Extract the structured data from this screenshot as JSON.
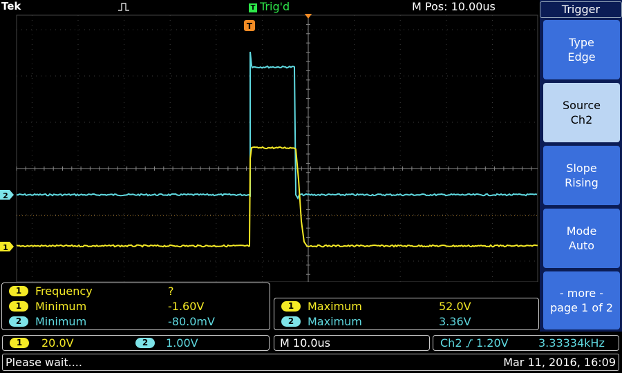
{
  "header": {
    "brand": "Tek",
    "trigger_status": "Trig'd",
    "trigger_status_badge": "T",
    "horizontal_position": "M Pos: 10.00us",
    "trigger_marker": "T"
  },
  "channel_markers": {
    "ch1": "1",
    "ch2": "2"
  },
  "side_menu": {
    "title": "Trigger",
    "buttons": [
      {
        "line1": "Type",
        "line2": "Edge"
      },
      {
        "line1": "Source",
        "line2": "Ch2"
      },
      {
        "line1": "Slope",
        "line2": "Rising"
      },
      {
        "line1": "Mode",
        "line2": "Auto"
      },
      {
        "line1": "- more -",
        "line2": "page 1 of 2"
      }
    ]
  },
  "measurements_left": [
    {
      "channel": "1",
      "name": "Frequency",
      "value": "?"
    },
    {
      "channel": "1",
      "name": "Minimum",
      "value": "-1.60V"
    },
    {
      "channel": "2",
      "name": "Minimum",
      "value": "-80.0mV"
    }
  ],
  "measurements_right": [
    {
      "channel": "1",
      "name": "Maximum",
      "value": "52.0V"
    },
    {
      "channel": "2",
      "name": "Maximum",
      "value": "3.36V"
    }
  ],
  "scales": {
    "ch1_channel": "1",
    "ch1_scale": "20.0V",
    "ch2_channel": "2",
    "ch2_scale": "1.00V",
    "horizontal": "M 10.0us",
    "trigger_source": "Ch2",
    "trigger_level": "1.20V",
    "trigger_frequency": "3.33334kHz"
  },
  "status": {
    "message": "Please wait....",
    "datetime": "Mar 11, 2016, 16:09"
  },
  "colors": {
    "ch1": "#f5ea26",
    "ch2": "#5fd9e0",
    "graticule": "#5a5a5a",
    "trigger": "#f08a24",
    "menu_button": "#3a6fdc",
    "menu_selected": "#bcd6f3"
  }
}
